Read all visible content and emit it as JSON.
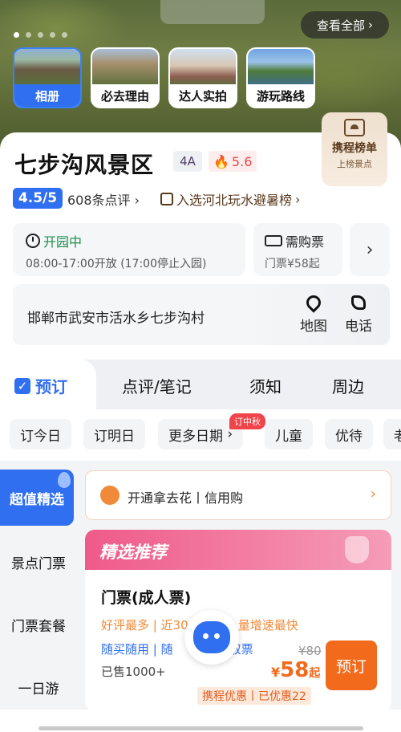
{
  "hero": {
    "view_all": "查看全部",
    "thumbs": [
      "相册",
      "必去理由",
      "达人实拍",
      "游玩路线"
    ]
  },
  "rank_badge": {
    "title": "携程榜单",
    "subtitle": "上榜景点"
  },
  "spot": {
    "name": "七步沟风景区",
    "level": "4A",
    "heat": "5.6",
    "score": "4.5/5",
    "reviews": "608条点评",
    "award": "入选河北玩水避暑榜"
  },
  "open": {
    "status": "开园中",
    "hours": "08:00-17:00开放 (17:00停止入园)"
  },
  "ticket": {
    "title": "需购票",
    "price": "门票¥58起"
  },
  "address": {
    "text": "邯郸市武安市活水乡七步沟村",
    "map": "地图",
    "phone": "电话"
  },
  "tabs": [
    "预订",
    "点评/笔记",
    "须知",
    "周边"
  ],
  "dates": {
    "chips": [
      "订今日",
      "订明日",
      "更多日期",
      "儿童",
      "优待",
      "老"
    ],
    "badge": "订中秋"
  },
  "side": [
    "超值精选",
    "景点门票",
    "门票套餐",
    "一日游"
  ],
  "promo": {
    "text": "开通拿去花丨信用购"
  },
  "recommend": {
    "title": "精选推荐",
    "product": "门票(成人票)",
    "line1": "好评最多 | 近30",
    "line1_tail": "量增速最快",
    "line2": "随买随用 | 随",
    "line2_tail": "取票",
    "sold": "已售1000+",
    "orig": "¥80",
    "price_sym": "¥",
    "price": "58",
    "price_suffix": "起",
    "book": "预订",
    "discount": "携程优惠丨已优惠22"
  },
  "colors": {
    "accent": "#2f6ff0",
    "orange": "#f26b1d",
    "green": "#1a8f4a"
  }
}
